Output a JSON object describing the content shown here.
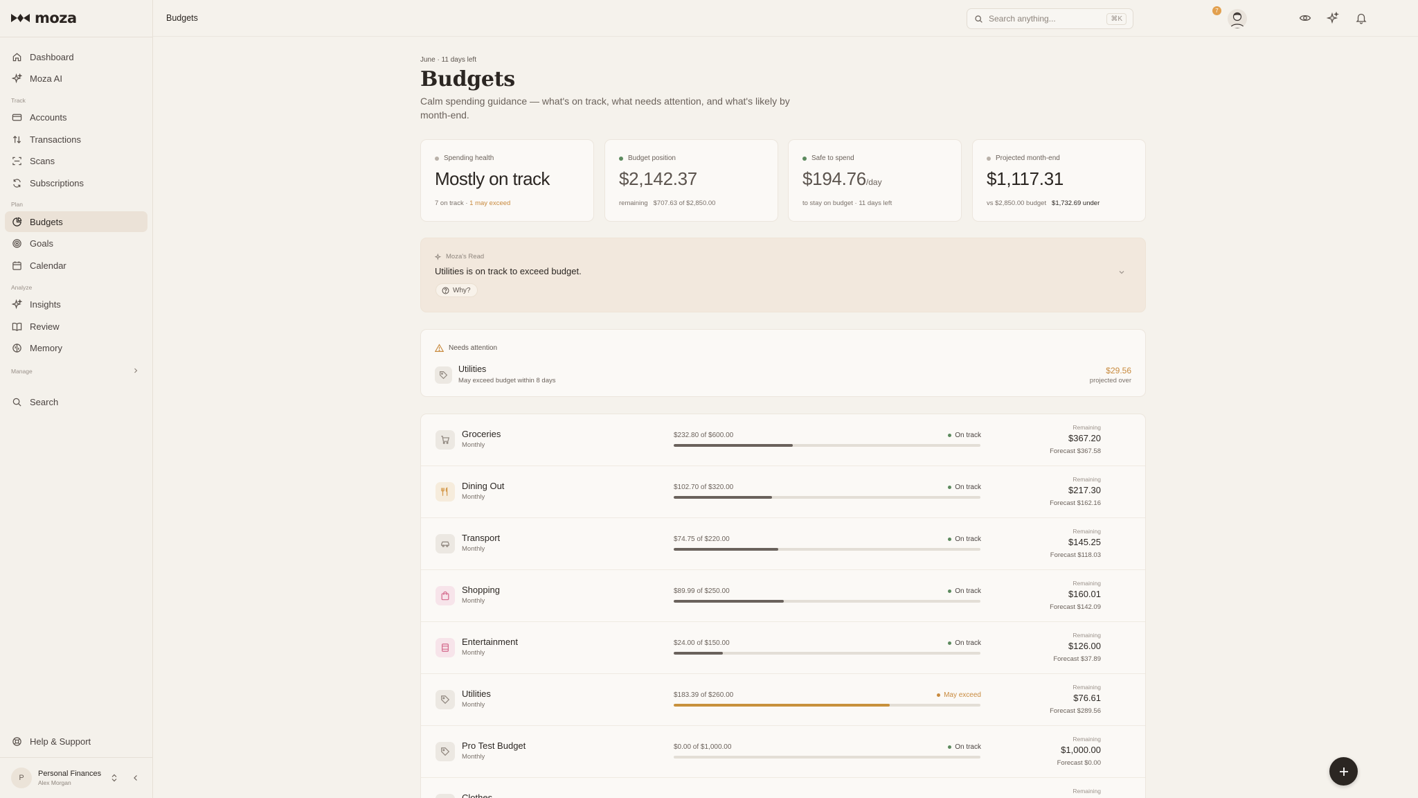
{
  "app": {
    "brand": "moza"
  },
  "sidebar": {
    "items_top": [
      {
        "label": "Dashboard",
        "icon": "home-icon"
      },
      {
        "label": "Moza AI",
        "icon": "sparkle-icon"
      }
    ],
    "section_track": "Track",
    "items_track": [
      {
        "label": "Accounts",
        "icon": "card-icon"
      },
      {
        "label": "Transactions",
        "icon": "arrows-icon"
      },
      {
        "label": "Scans",
        "icon": "scan-icon"
      },
      {
        "label": "Subscriptions",
        "icon": "repeat-icon"
      }
    ],
    "section_plan": "Plan",
    "items_plan": [
      {
        "label": "Budgets",
        "icon": "pie-icon",
        "active": true
      },
      {
        "label": "Goals",
        "icon": "target-icon"
      },
      {
        "label": "Calendar",
        "icon": "calendar-icon"
      }
    ],
    "section_analyze": "Analyze",
    "items_analyze": [
      {
        "label": "Insights",
        "icon": "sparkle-icon"
      },
      {
        "label": "Review",
        "icon": "book-icon"
      },
      {
        "label": "Memory",
        "icon": "brain-icon"
      }
    ],
    "section_manage": "Manage",
    "search_label": "Search",
    "help_label": "Help & Support",
    "account": {
      "initial": "P",
      "name": "Personal Finances",
      "user": "Alex Morgan"
    }
  },
  "topbar": {
    "breadcrumb": "Budgets",
    "search_placeholder": "Search anything...",
    "search_shortcut": "⌘K",
    "notification_count": "7"
  },
  "page": {
    "eyebrow": "June · 11 days left",
    "title": "Budgets",
    "subtitle": "Calm spending guidance — what's on track, what needs attention, and what's likely by month-end."
  },
  "summary_cards": [
    {
      "label": "Spending health",
      "dot_color": "#b9b1a9",
      "value": "Mostly on track",
      "sub_a": "7 on track",
      "sub_sep": "·",
      "sub_b": "1 may exceed"
    },
    {
      "label": "Budget position",
      "dot_color": "#5c8a5e",
      "value": "$2,142.37",
      "sub_a": "remaining",
      "sub_b": "$707.63 of $2,850.00"
    },
    {
      "label": "Safe to spend",
      "dot_color": "#5c8a5e",
      "value": "$194.76",
      "unit": "/day",
      "sub_a": "to stay on budget · 11 days left"
    },
    {
      "label": "Projected month-end",
      "dot_color": "#b9b1a9",
      "value": "$1,117.31",
      "sub_a": "vs $2,850.00 budget",
      "sub_b": "$1,732.69 under"
    }
  ],
  "moza_read": {
    "label": "Moza's Read",
    "text": "Utilities is on track to exceed budget.",
    "why_label": "Why?"
  },
  "needs_attention": {
    "label": "Needs attention",
    "items": [
      {
        "name": "Utilities",
        "description": "May exceed budget within 8 days",
        "amount": "$29.56",
        "amount_label": "projected over"
      }
    ]
  },
  "budgets": [
    {
      "name": "Groceries",
      "period": "Monthly",
      "spent": "$232.80 of $600.00",
      "progress": 0.388,
      "status": "On track",
      "remaining_label": "Remaining",
      "remaining": "$367.20",
      "forecast": "Forecast $367.58",
      "icon": "cart-icon",
      "icon_color": "#8d847c",
      "icon_bg": "#ece8e2"
    },
    {
      "name": "Dining Out",
      "period": "Monthly",
      "spent": "$102.70 of $320.00",
      "progress": 0.321,
      "status": "On track",
      "remaining_label": "Remaining",
      "remaining": "$217.30",
      "forecast": "Forecast $162.16",
      "icon": "utensils-icon",
      "icon_color": "#d49a4c",
      "icon_bg": "#f6ecdc"
    },
    {
      "name": "Transport",
      "period": "Monthly",
      "spent": "$74.75 of $220.00",
      "progress": 0.34,
      "status": "On track",
      "remaining_label": "Remaining",
      "remaining": "$145.25",
      "forecast": "Forecast $118.03",
      "icon": "car-icon",
      "icon_color": "#8d847c",
      "icon_bg": "#ece8e2"
    },
    {
      "name": "Shopping",
      "period": "Monthly",
      "spent": "$89.99 of $250.00",
      "progress": 0.36,
      "status": "On track",
      "remaining_label": "Remaining",
      "remaining": "$160.01",
      "forecast": "Forecast $142.09",
      "icon": "bag-icon",
      "icon_color": "#d46a8c",
      "icon_bg": "#f7e4ea"
    },
    {
      "name": "Entertainment",
      "period": "Monthly",
      "spent": "$24.00 of $150.00",
      "progress": 0.16,
      "status": "On track",
      "remaining_label": "Remaining",
      "remaining": "$126.00",
      "forecast": "Forecast $37.89",
      "icon": "film-icon",
      "icon_color": "#d46a8c",
      "icon_bg": "#f7e4ea"
    },
    {
      "name": "Utilities",
      "period": "Monthly",
      "spent": "$183.39 of $260.00",
      "progress": 0.705,
      "status": "May exceed",
      "status_color": "#c88a3e",
      "bar_color": "#c8913c",
      "remaining_label": "Remaining",
      "remaining": "$76.61",
      "forecast": "Forecast $289.56",
      "icon": "tag-icon",
      "icon_color": "#8d847c",
      "icon_bg": "#ece8e2"
    },
    {
      "name": "Pro Test Budget",
      "period": "Monthly",
      "spent": "$0.00 of $1,000.00",
      "progress": 0,
      "status": "On track",
      "remaining_label": "Remaining",
      "remaining": "$1,000.00",
      "forecast": "Forecast $0.00",
      "icon": "tag-icon",
      "icon_color": "#8d847c",
      "icon_bg": "#ece8e2"
    },
    {
      "name": "Clothes",
      "period": "",
      "spent": "",
      "progress": 0,
      "status": "",
      "remaining_label": "Remaining",
      "remaining": "",
      "forecast": "",
      "icon": "tag-icon",
      "icon_color": "#8d847c",
      "icon_bg": "#ece8e2"
    }
  ],
  "colors": {
    "accent": "#c88a3e",
    "on_track_dot": "#5c8a5e",
    "active_nav_bg": "#ebe2d7",
    "fab": "#2b2622"
  }
}
